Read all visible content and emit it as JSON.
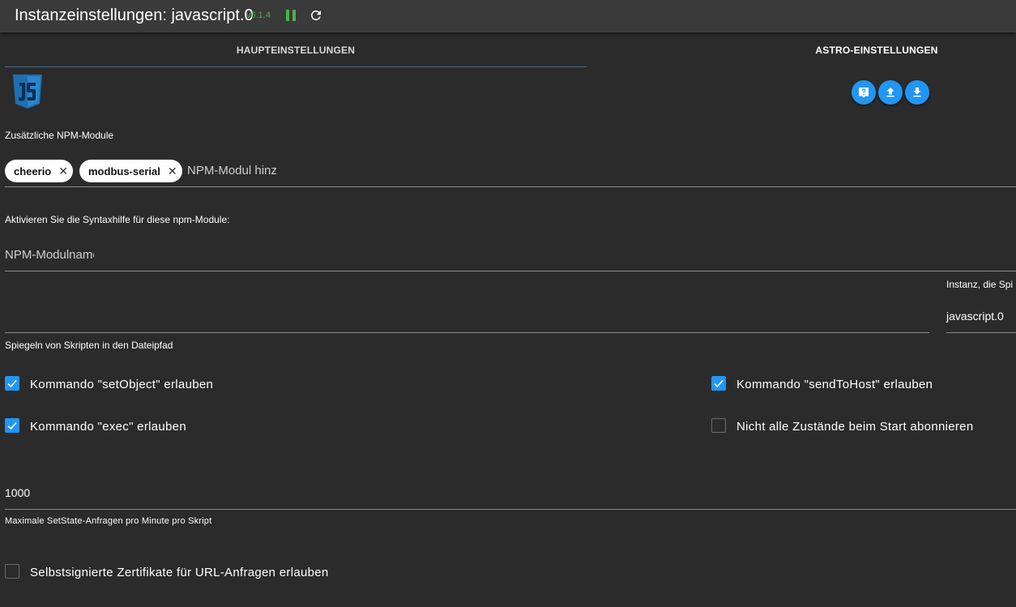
{
  "header": {
    "title": "Instanzeinstellungen: javascript.0",
    "version": "v6.1.4"
  },
  "tabs": [
    {
      "label": "HAUPTEINSTELLUNGEN",
      "active": true
    },
    {
      "label": "ASTRO-EINSTELLUNGEN",
      "active": false
    }
  ],
  "npm": {
    "label": "Zusätzliche NPM-Module",
    "chips": [
      "cheerio",
      "modbus-serial"
    ],
    "add_placeholder": "NPM-Modul hinz"
  },
  "syntax": {
    "label": "Aktivieren Sie die Syntaxhilfe für diese npm-Module:",
    "placeholder": "NPM-Modulname"
  },
  "mirror": {
    "path_label": "Spiegeln von Skripten in den Dateipfad",
    "path_value": "",
    "instance_label": "Instanz, die Spi",
    "instance_value": "javascript.0"
  },
  "checkboxes": {
    "set_object": {
      "label": "Kommando \"setObject\" erlauben",
      "checked": true
    },
    "exec": {
      "label": "Kommando \"exec\" erlauben",
      "checked": true
    },
    "send_to_host": {
      "label": "Kommando \"sendToHost\" erlauben",
      "checked": true
    },
    "no_subscribe": {
      "label": "Nicht alle Zustände beim Start abonnieren",
      "checked": false
    },
    "self_signed": {
      "label": "Selbstsignierte Zertifikate für URL-Anfragen erlauben",
      "checked": false
    }
  },
  "max_setstate": {
    "value": "1000",
    "label": "Maximale SetState-Anfragen pro Minute pro Skript"
  },
  "colors": {
    "accent": "#2196f3",
    "background": "#2b2b2b",
    "titlebar": "#3a3a3a",
    "version": "#4caf50"
  }
}
